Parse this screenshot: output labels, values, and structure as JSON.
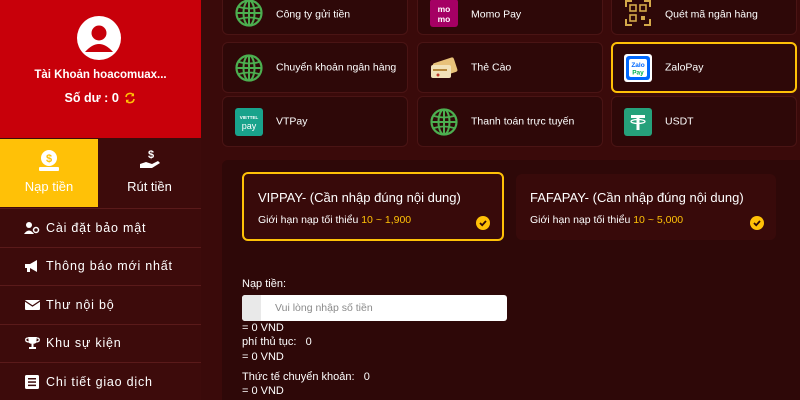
{
  "profile": {
    "account_label": "Tài Khoản hoacomuax...",
    "balance_label": "Số dư :",
    "balance_value": "0"
  },
  "tabs": {
    "deposit": "Nạp tiền",
    "withdraw": "Rút tiền"
  },
  "menu": [
    {
      "label": "Cài đặt bảo mật",
      "icon": "users-gear-icon"
    },
    {
      "label": "Thông báo mới nhất",
      "icon": "megaphone-icon"
    },
    {
      "label": "Thư nội bộ",
      "icon": "envelope-icon"
    },
    {
      "label": "Khu sự kiện",
      "icon": "trophy-icon"
    },
    {
      "label": "Chi tiết giao dịch",
      "icon": "list-icon"
    }
  ],
  "payment_methods": [
    {
      "label": "Công ty gửi tiền",
      "icon": "globe-icon"
    },
    {
      "label": "Momo Pay",
      "icon": "momo-logo"
    },
    {
      "label": "Quét mã ngân hàng",
      "icon": "qr-scan-icon"
    },
    {
      "label": "Chuyển khoản ngân hàng",
      "icon": "globe-icon"
    },
    {
      "label": "Thẻ Cào",
      "icon": "scratch-card-icon"
    },
    {
      "label": "ZaloPay",
      "icon": "zalopay-logo"
    },
    {
      "label": "VTPay",
      "icon": "vtpay-logo"
    },
    {
      "label": "Thanh toán trực tuyến",
      "icon": "globe-icon"
    },
    {
      "label": "USDT",
      "icon": "tether-logo"
    }
  ],
  "channels": [
    {
      "title": "VIPPAY- (Cần nhập đúng nội dung)",
      "limit_label": "Giới hạn nạp tối thiểu",
      "range": "10 ~ 1,900"
    },
    {
      "title": "FAFAPAY- (Cần nhập đúng nội dung)",
      "limit_label": "Giới hạn nạp tối thiểu",
      "range": "10 ~ 5,000"
    }
  ],
  "form": {
    "amount_label": "Nạp tiền:",
    "amount_placeholder": "Vui lòng nhập số tiền",
    "amount_converted": "= 0 VND",
    "fee_label": "phí thủ tục:",
    "fee_value": "0",
    "fee_converted": "= 0 VND",
    "actual_label": "Thức tế chuyển khoản:",
    "actual_value": "0",
    "actual_converted": "= 0 VND"
  },
  "colors": {
    "accent": "#ffc107",
    "profile_bg": "#c8000a",
    "background": "#3a0a0a",
    "card_bg": "#2e0808",
    "globe_green": "#4caf50"
  }
}
